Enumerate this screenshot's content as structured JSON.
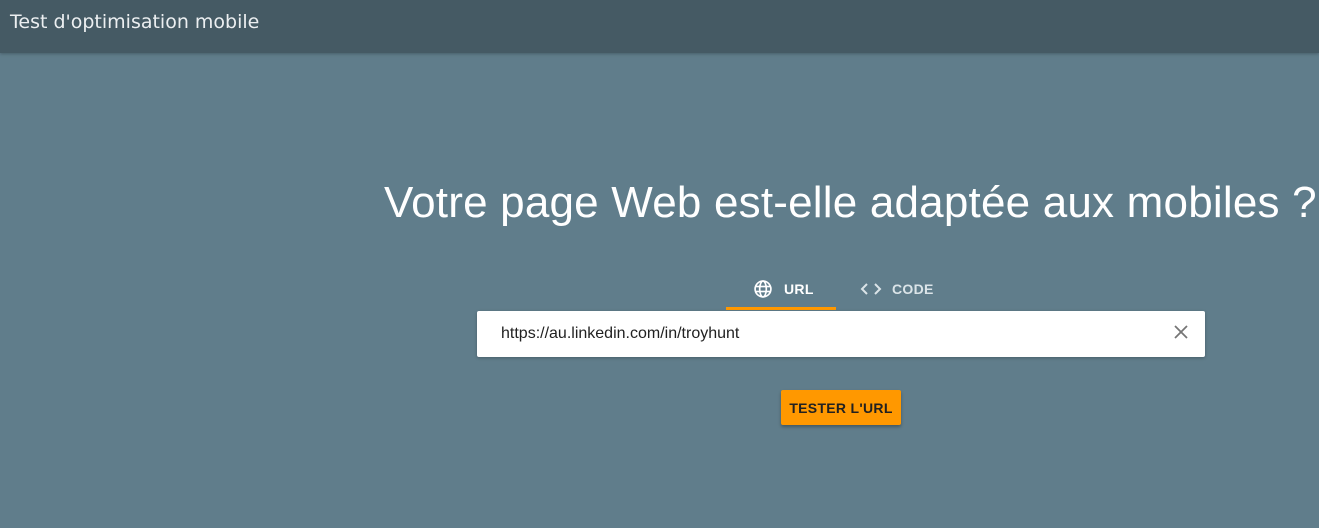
{
  "header": {
    "title": "Test d'optimisation mobile"
  },
  "main": {
    "headline": "Votre page Web est-elle adaptée aux mobiles ?",
    "tabs": [
      {
        "label": "URL",
        "icon": "globe-icon",
        "selected": true
      },
      {
        "label": "CODE",
        "icon": "code-brackets-icon",
        "selected": false
      }
    ],
    "url_input": {
      "value": "https://au.linkedin.com/in/troyhunt",
      "placeholder": ""
    },
    "clear_icon": "close-icon",
    "test_button_label": "TESTER L'URL"
  },
  "colors": {
    "background": "#607d8b",
    "header_bar": "#455a64",
    "accent": "#ff9800",
    "text_light": "#ffffff"
  }
}
